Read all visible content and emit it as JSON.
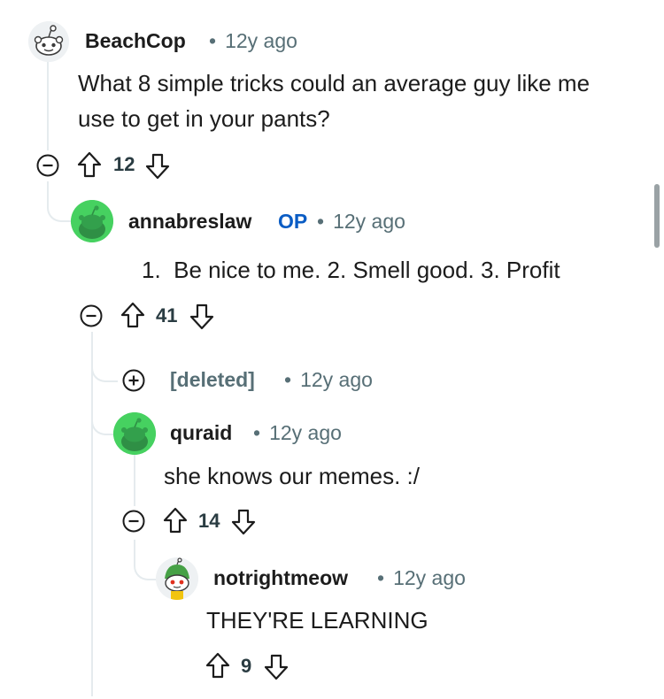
{
  "comments": [
    {
      "username": "BeachCop",
      "time": "12y ago",
      "body": "What 8 simple tricks could an average guy like me use to get in your pants?",
      "score": "12",
      "avatar_icon": "reddit-snoo-default-icon"
    },
    {
      "username": "annabreslaw",
      "op_label": "OP",
      "time": "12y ago",
      "body": "1.  Be nice to me. 2. Smell good. 3. Profit",
      "score": "41",
      "avatar_icon": "reddit-snoo-green-icon"
    },
    {
      "username": "[deleted]",
      "time": "12y ago",
      "collapsed": true
    },
    {
      "username": "quraid",
      "time": "12y ago",
      "body": "she knows our memes. :/",
      "score": "14",
      "avatar_icon": "reddit-snoo-green-icon"
    },
    {
      "username": "notrightmeow",
      "time": "12y ago",
      "body": "THEY'RE LEARNING",
      "score": "9",
      "avatar_icon": "reddit-snoo-custom-icon"
    }
  ],
  "colors": {
    "op": "#0a5cc4",
    "meta": "#576f76",
    "thread_line": "#e5ebee",
    "avatar_green": "#46d160"
  }
}
